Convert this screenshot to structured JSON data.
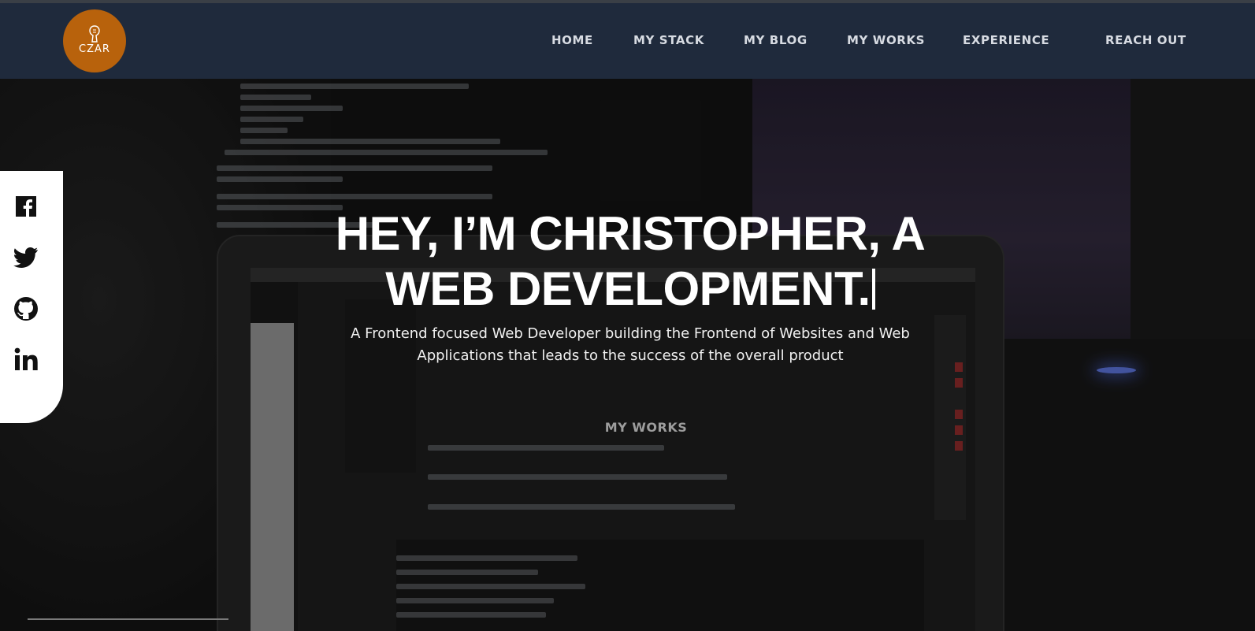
{
  "header": {
    "logo_text": "CZAR",
    "nav": {
      "home": "HOME",
      "my_stack": "MY STACK",
      "my_blog": "MY BLOG",
      "my_works": "MY WORKS",
      "experience": "EXPERIENCE",
      "reach_out": "REACH OUT"
    }
  },
  "social": {
    "icons": [
      "facebook-icon",
      "twitter-icon",
      "github-icon",
      "linkedin-icon"
    ]
  },
  "hero": {
    "title_line1": "HEY, I’M CHRISTOPHER, A",
    "title_line2": "WEB DEVELOPMENT.",
    "subtitle": "A Frontend focused Web Developer building the Frontend of Websites and Web Applications that leads to the success of the overall product",
    "cta": "MY WORKS"
  },
  "colors": {
    "header_bg": "#1f2a3c",
    "logo_bg": "#b8620c",
    "nav_text": "#d7dbe2",
    "cta_text": "#9d9d9d"
  }
}
